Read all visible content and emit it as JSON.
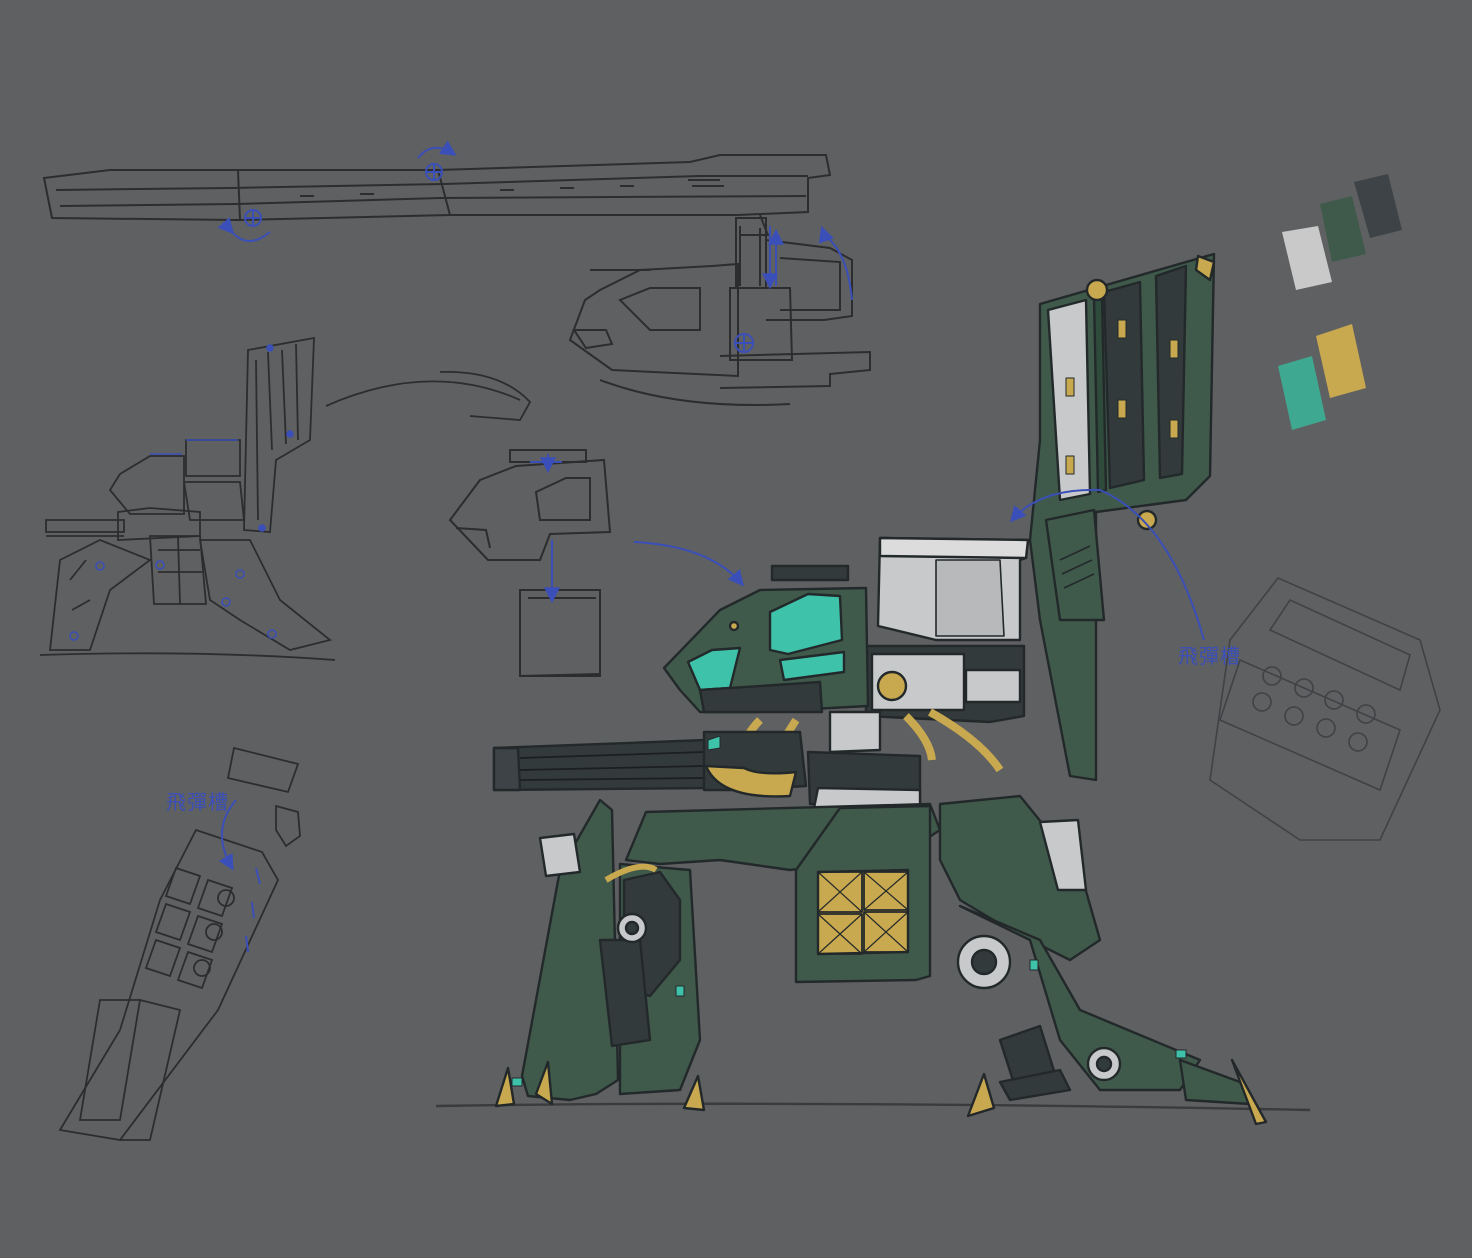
{
  "annotations": {
    "missile_rack_right": "飛彈槽",
    "missile_rack_left": "飛彈槽"
  },
  "palette": [
    {
      "name": "light-grey",
      "color": "#c9c9c9"
    },
    {
      "name": "dark-green",
      "color": "#3f5a4b"
    },
    {
      "name": "charcoal",
      "color": "#3d4346"
    },
    {
      "name": "teal",
      "color": "#3fa890"
    },
    {
      "name": "mustard",
      "color": "#c9a94f"
    }
  ],
  "colors": {
    "background": "#5f6062",
    "sketch_line": "#2c2d2f",
    "guide_blue": "#3b4fb8",
    "armor_green": "#3f5a4b",
    "armor_dark": "#333a3b",
    "glass_teal": "#3fc2aa",
    "brass": "#c9a94f",
    "panel_grey": "#c7c9ca"
  }
}
